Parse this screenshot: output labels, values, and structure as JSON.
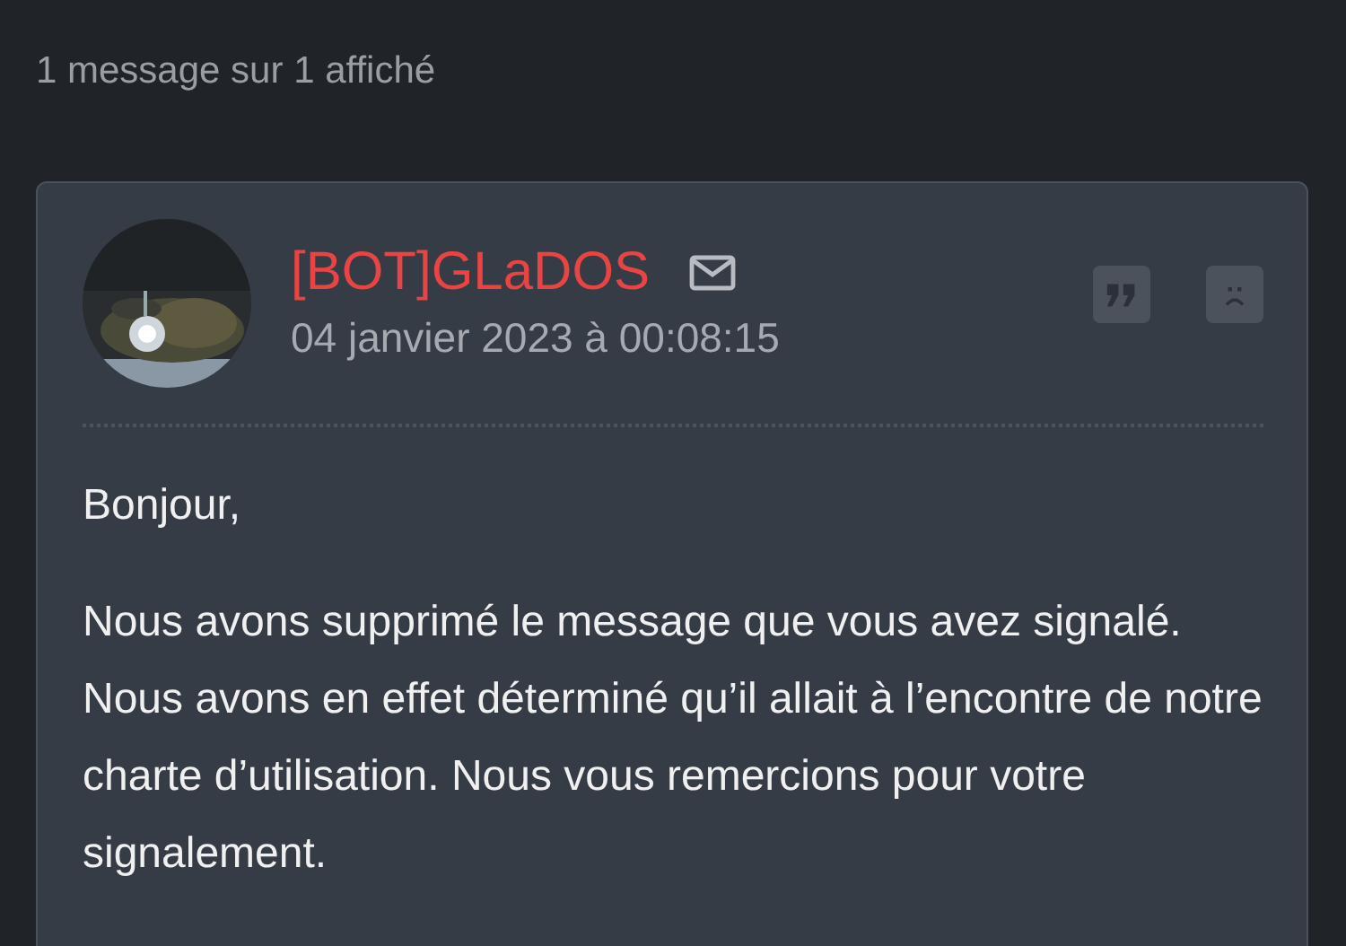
{
  "header": {
    "count_text": "1 message sur 1 affiché"
  },
  "message": {
    "author": "[BOT]GLaDOS",
    "date": "04 janvier 2023 à 00:08:15",
    "paragraphs": [
      "Bonjour,",
      "Nous avons supprimé le message que vous avez signalé. Nous avons en effet déterminé qu’il allait à l’encontre de notre charte d’utilisation. Nous vous remercions pour votre signalement."
    ]
  }
}
